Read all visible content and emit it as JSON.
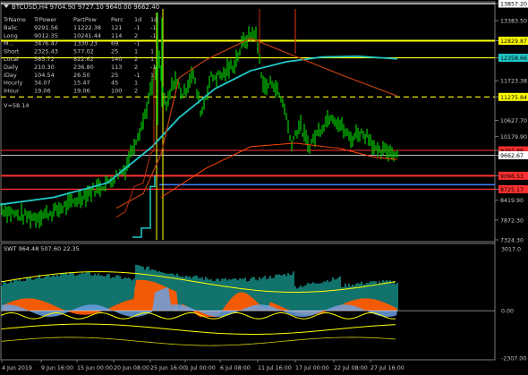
{
  "window": {
    "symbol_line": "BTCUSD,H4  9704.90 9727.10 9640.00 9662.40",
    "indicator_label": "V=58.14"
  },
  "stats_table": {
    "headers": [
      "TrName",
      "TrPower",
      "PartPow",
      "Perc",
      "1d",
      "1d"
    ],
    "rows": [
      [
        "Balic",
        "9291.56",
        "11222.38",
        "121",
        "-1",
        "-1"
      ],
      [
        "Long",
        "9012.35",
        "10241.44",
        "114",
        "2",
        "-1"
      ],
      [
        "M...",
        "3476.47",
        "1330.23",
        "69",
        "-1",
        ""
      ],
      [
        "Short",
        "2325.43",
        "577.02",
        "25",
        "1",
        "1"
      ],
      [
        "Local",
        "585.72",
        "822.62",
        "140",
        "2",
        "1"
      ],
      [
        "Daily",
        "210.30",
        "236.80",
        "113",
        "2",
        "-1"
      ],
      [
        "IDay",
        "104.54",
        "26.50",
        "25",
        "-1",
        "1"
      ],
      [
        "Hourly",
        "34.07",
        "15.47",
        "45",
        "1",
        ""
      ],
      [
        "IHour",
        "19.06",
        "19.06",
        "100",
        "2",
        ""
      ]
    ]
  },
  "price_axis": [
    "13857.20",
    "13383.50",
    "12829.87",
    "12358.66",
    "11723.38",
    "11275.84",
    "10627.70",
    "10179.90",
    "9797.86",
    "9662.67",
    "9096.53",
    "8725.17",
    "8419.90",
    "7872.30",
    "7324.30"
  ],
  "price_badges": [
    {
      "label": "13857.20",
      "color": "#ffffff"
    },
    {
      "label": "12829.87",
      "color": "#ffff00"
    },
    {
      "label": "12358.66",
      "color": "#20c8c8"
    },
    {
      "label": "11275.84",
      "color": "#ffff00"
    },
    {
      "label": "9797.86",
      "color": "#ff3030"
    },
    {
      "label": "9662.67",
      "color": "#ffffff"
    },
    {
      "label": "9096.53",
      "color": "#ff3030"
    },
    {
      "label": "8725.17",
      "color": "#ff3030"
    }
  ],
  "osc": {
    "label": "SWT 964.48 507.60 22.35",
    "axis": [
      "3017.0",
      "0.00",
      "-2307.00"
    ]
  },
  "time_axis": [
    "4 Jun 2019",
    "9 Jun 16:00",
    "15 Jun 00:00",
    "20 Jun 08:00",
    "25 Jun 16:00",
    "1 Jul 00:00",
    "6 Jul 08:00",
    "11 Jul 16:00",
    "17 Jul 00:00",
    "22 Jul 08:00",
    "27 Jul 16:00"
  ],
  "colors": {
    "bull": "#00c000",
    "bear": "#00c000",
    "ma_fast": "#ff4500",
    "ma_slow": "#20c8c8",
    "res": "#ffff00",
    "sup": "#ff3030",
    "osc_teal": "#1aa39a",
    "osc_orange": "#ff5a00",
    "osc_blue": "#6aa0e0"
  },
  "chart_data": {
    "type": "line",
    "title": "BTCUSD,H4",
    "x": [
      "4 Jun",
      "9 Jun",
      "15 Jun",
      "20 Jun",
      "25 Jun",
      "1 Jul",
      "6 Jul",
      "11 Jul",
      "17 Jul",
      "22 Jul",
      "27 Jul"
    ],
    "series": [
      {
        "name": "",
        "values": [
          8000,
          7900,
          8600,
          9300,
          11200,
          11300,
          12000,
          11300,
          9800,
          10000,
          9660
        ]
      }
    ],
    "ylim": [
      7324.3,
      13857.2
    ]
  }
}
